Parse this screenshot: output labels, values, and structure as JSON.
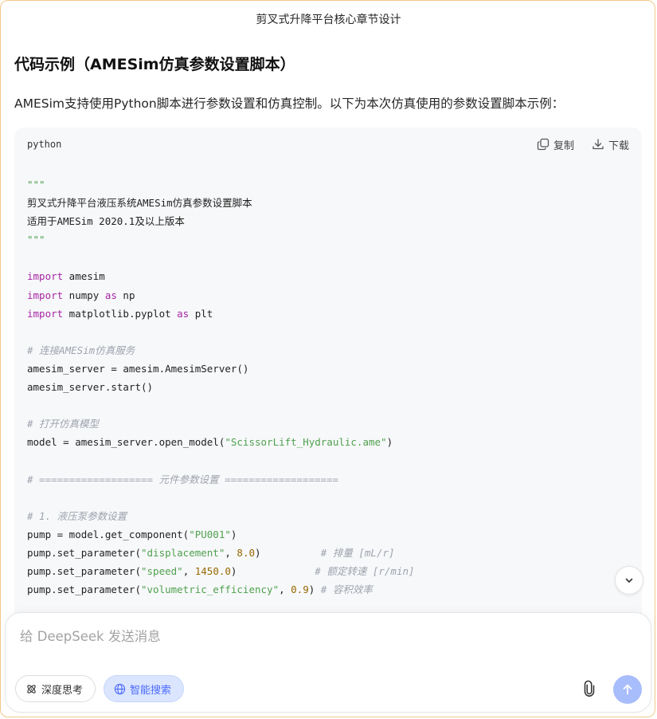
{
  "header": {
    "title": "剪叉式升降平台核心章节设计"
  },
  "section": {
    "title": "代码示例（AMESim仿真参数设置脚本）",
    "intro": "AMESim支持使用Python脚本进行参数设置和仿真控制。以下为本次仿真使用的参数设置脚本示例："
  },
  "code": {
    "language": "python",
    "copy_label": "复制",
    "download_label": "下载",
    "lines": [
      "\"\"\"",
      "剪叉式升降平台液压系统AMESim仿真参数设置脚本",
      "适用于AMESim 2020.1及以上版本",
      "\"\"\"",
      "",
      "import amesim",
      "import numpy as np",
      "import matplotlib.pyplot as plt",
      "",
      "# 连接AMESim仿真服务",
      "amesim_server = amesim.AmesimServer()",
      "amesim_server.start()",
      "",
      "# 打开仿真模型",
      "model = amesim_server.open_model(\"ScissorLift_Hydraulic.ame\")",
      "",
      "# =================== 元件参数设置 ===================",
      "",
      "# 1. 液压泵参数设置",
      "pump = model.get_component(\"PU001\")",
      "pump.set_parameter(\"displacement\", 8.0)          # 排量 [mL/r]",
      "pump.set_parameter(\"speed\", 1450.0)             # 额定转速 [r/min]",
      "pump.set_parameter(\"volumetric_efficiency\", 0.9) # 容积效率"
    ]
  },
  "composer": {
    "placeholder": "给 DeepSeek 发送消息",
    "deep_think_label": "深度思考",
    "smart_search_label": "智能搜索"
  },
  "colors": {
    "accent": "#4d6bfe",
    "send_disabled": "#a8bdfb",
    "keyword": "#a626a4",
    "string": "#50a14f",
    "number": "#986801",
    "comment": "#9ea3ad"
  }
}
